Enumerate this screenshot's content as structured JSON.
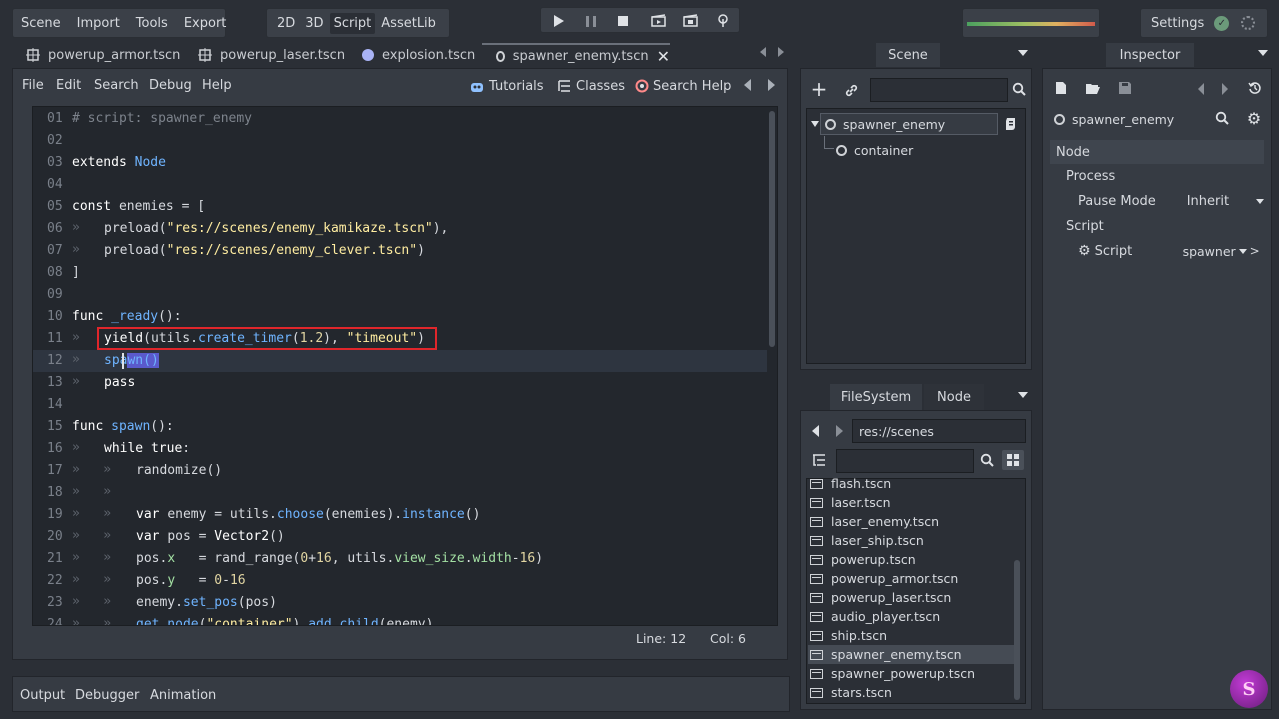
{
  "menu": {
    "items": [
      "Scene",
      "Import",
      "Tools",
      "Export"
    ],
    "modes": [
      "2D",
      "3D",
      "Script",
      "AssetLib"
    ],
    "active_mode": "Script",
    "settings_label": "Settings"
  },
  "tabs": [
    {
      "label": "powerup_armor.tscn",
      "icon": "node2d-icon"
    },
    {
      "label": "powerup_laser.tscn",
      "icon": "node2d-icon"
    },
    {
      "label": "explosion.tscn",
      "icon": "particles-icon"
    },
    {
      "label": "spawner_enemy.tscn",
      "icon": "node-icon",
      "active": true
    }
  ],
  "script_menu": {
    "items": [
      "File",
      "Edit",
      "Search",
      "Debug",
      "Help"
    ],
    "right": [
      "Tutorials",
      "Classes",
      "Search Help"
    ]
  },
  "code": {
    "lines": [
      "01",
      "02",
      "03",
      "04",
      "05",
      "06",
      "07",
      "08",
      "09",
      "10",
      "11",
      "12",
      "13",
      "14",
      "15",
      "16",
      "17",
      "18",
      "19",
      "20",
      "21",
      "22",
      "23",
      "24"
    ],
    "status_line": "Line: 12",
    "status_col": "Col: 6"
  },
  "scene_panel": {
    "title": "Scene",
    "nodes": [
      "spawner_enemy",
      "container"
    ]
  },
  "inspector": {
    "title": "Inspector",
    "object": "spawner_enemy",
    "section": "Node",
    "process": "Process",
    "pause_mode_label": "Pause Mode",
    "pause_mode_value": "Inherit",
    "script_section": "Script",
    "script_label": "Script",
    "script_value": "spawner"
  },
  "filesystem": {
    "tab_fs": "FileSystem",
    "tab_node": "Node",
    "path": "res://scenes",
    "files": [
      "flash.tscn",
      "laser.tscn",
      "laser_enemy.tscn",
      "laser_ship.tscn",
      "powerup.tscn",
      "powerup_armor.tscn",
      "powerup_laser.tscn",
      "audio_player.tscn",
      "ship.tscn",
      "spawner_enemy.tscn",
      "spawner_powerup.tscn",
      "stars.tscn"
    ],
    "selected": "spawner_enemy.tscn"
  },
  "bottom": {
    "items": [
      "Output",
      "Debugger",
      "Animation"
    ]
  },
  "colors": {
    "bg": "#2b2f36",
    "editor_bg": "#23272d",
    "highlight_box": "#e0262b",
    "selection": "#5a5acc"
  }
}
